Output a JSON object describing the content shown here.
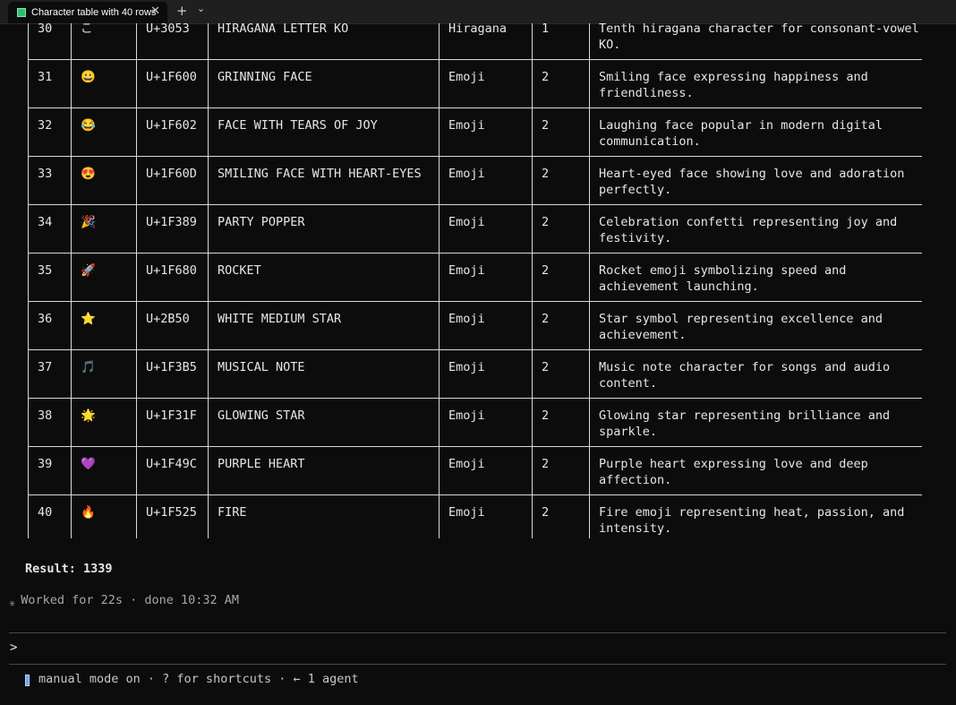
{
  "tab": {
    "title": "Character table with 40 rows",
    "close_glyph": "✕",
    "new_tab_glyph": "+",
    "dropdown_glyph": "⌄"
  },
  "table": {
    "rows": [
      {
        "num": "30",
        "char": "こ",
        "code": "U+3053",
        "name": "HIRAGANA LETTER KO",
        "category": "Hiragana",
        "width": "1",
        "description": "Tenth hiragana character for consonant-vowel KO."
      },
      {
        "num": "31",
        "char": "😀",
        "code": "U+1F600",
        "name": "GRINNING FACE",
        "category": "Emoji",
        "width": "2",
        "description": "Smiling face expressing happiness and friendliness."
      },
      {
        "num": "32",
        "char": "😂",
        "code": "U+1F602",
        "name": "FACE WITH TEARS OF JOY",
        "category": "Emoji",
        "width": "2",
        "description": "Laughing face popular in modern digital communication."
      },
      {
        "num": "33",
        "char": "😍",
        "code": "U+1F60D",
        "name": "SMILING FACE WITH HEART-EYES",
        "category": "Emoji",
        "width": "2",
        "description": "Heart-eyed face showing love and adoration perfectly."
      },
      {
        "num": "34",
        "char": "🎉",
        "code": "U+1F389",
        "name": "PARTY POPPER",
        "category": "Emoji",
        "width": "2",
        "description": "Celebration confetti representing joy and festivity."
      },
      {
        "num": "35",
        "char": "🚀",
        "code": "U+1F680",
        "name": "ROCKET",
        "category": "Emoji",
        "width": "2",
        "description": "Rocket emoji symbolizing speed and achievement launching."
      },
      {
        "num": "36",
        "char": "⭐",
        "code": "U+2B50",
        "name": "WHITE MEDIUM STAR",
        "category": "Emoji",
        "width": "2",
        "description": "Star symbol representing excellence and achievement."
      },
      {
        "num": "37",
        "char": "🎵",
        "code": "U+1F3B5",
        "name": "MUSICAL NOTE",
        "category": "Emoji",
        "width": "2",
        "description": "Music note character for songs and audio content."
      },
      {
        "num": "38",
        "char": "🌟",
        "code": "U+1F31F",
        "name": "GLOWING STAR",
        "category": "Emoji",
        "width": "2",
        "description": "Glowing star representing brilliance and sparkle."
      },
      {
        "num": "39",
        "char": "💜",
        "code": "U+1F49C",
        "name": "PURPLE HEART",
        "category": "Emoji",
        "width": "2",
        "description": "Purple heart expressing love and deep affection."
      },
      {
        "num": "40",
        "char": "🔥",
        "code": "U+1F525",
        "name": "FIRE",
        "category": "Emoji",
        "width": "2",
        "description": "Fire emoji representing heat, passion, and intensity."
      }
    ]
  },
  "result": "Result: 1339",
  "worked": {
    "icon": "spinner-asterisk",
    "text": "Worked for 22s · done 10:32 AM"
  },
  "prompt": {
    "glyph": ">"
  },
  "status": {
    "text": "manual mode on · ? for shortcuts · ← 1 agent"
  },
  "colors": {
    "background": "#0c0c0c",
    "text": "#e6e6e6",
    "table_border": "#d9d9d9",
    "tab_icon": "#2fbf71",
    "mode_icon": "#6aa7ff"
  }
}
